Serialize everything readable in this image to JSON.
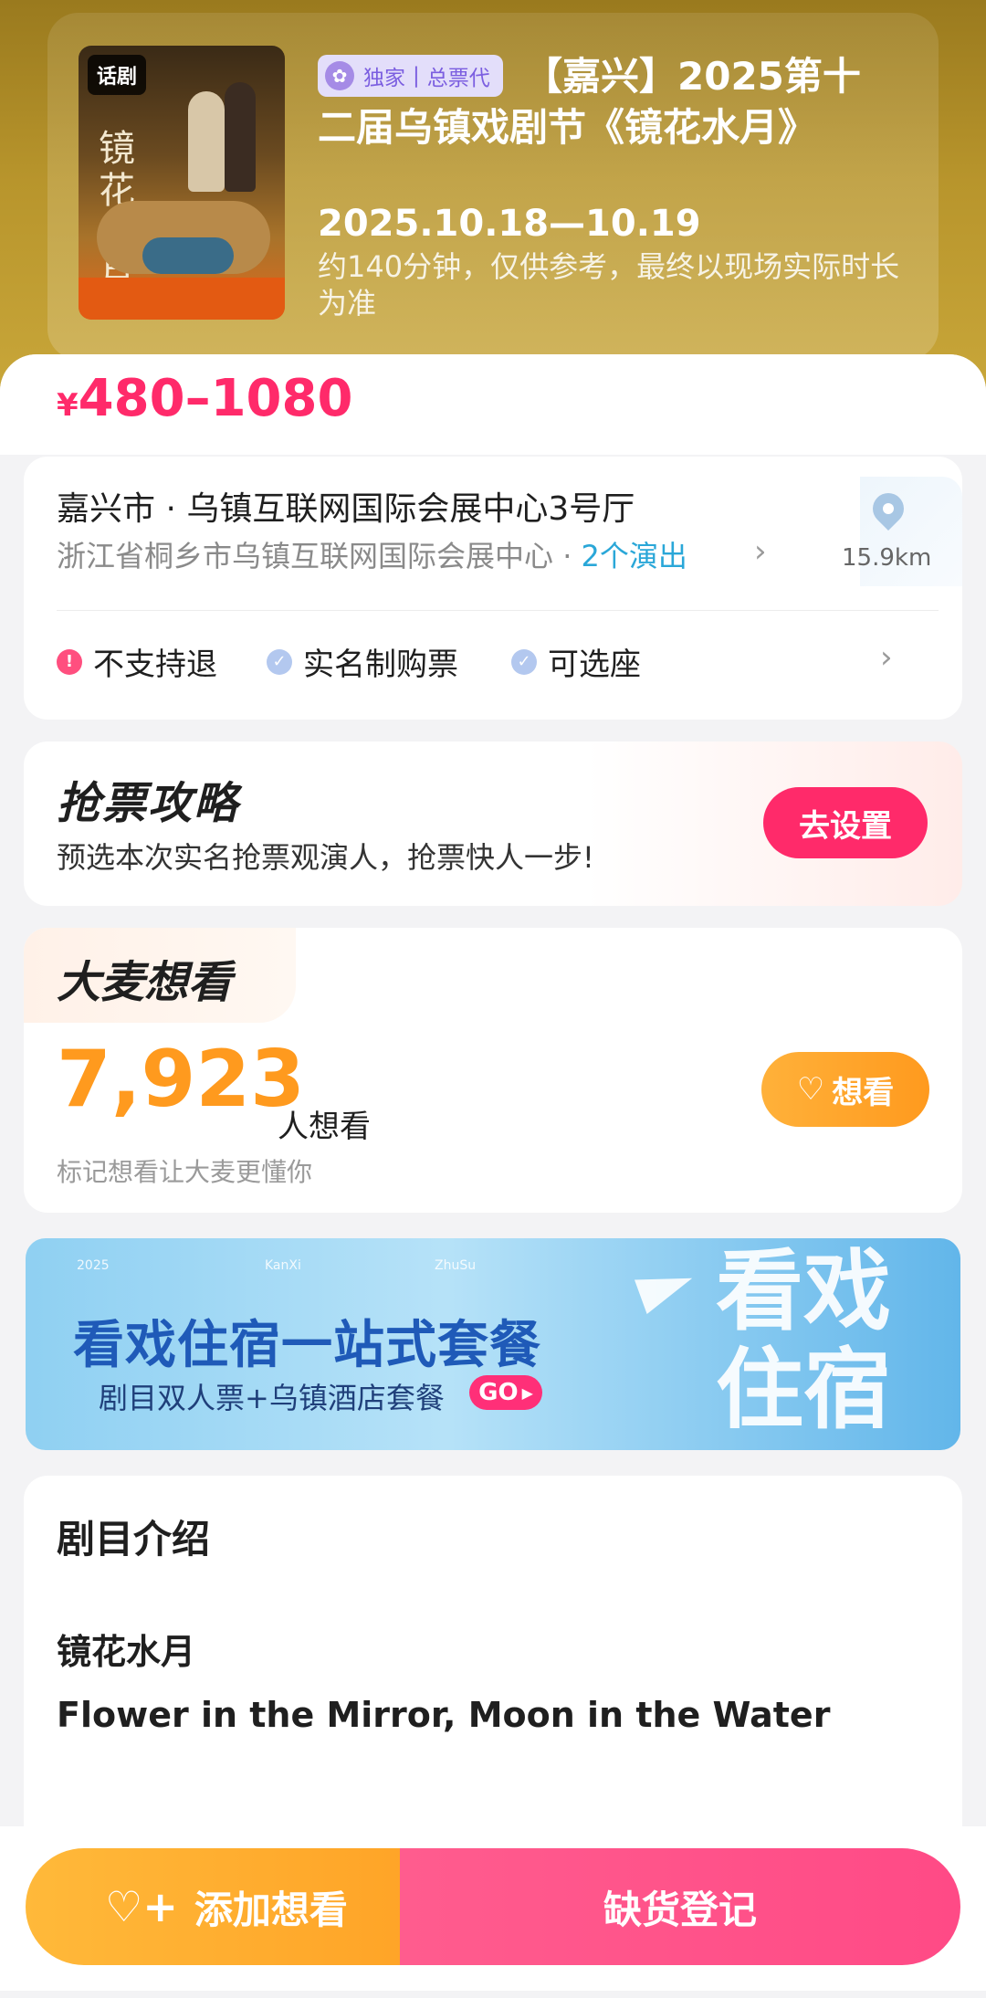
{
  "hero": {
    "poster_tag": "话剧",
    "poster_title": "镜花水月",
    "badge_exclusive": "独家",
    "badge_agent": "总票代",
    "title": "【嘉兴】2025第十二届乌镇戏剧节《镜花水月》",
    "date": "2025.10.18—10.19",
    "duration": "约140分钟，仅供参考，最终以现场实际时长为准"
  },
  "price": {
    "currency": "¥",
    "range": "480–1080"
  },
  "venue": {
    "city_line": "嘉兴市 · 乌镇互联网国际会展中心3号厅",
    "address": "浙江省桐乡市乌镇互联网国际会展中心",
    "shows": "2个演出",
    "distance": "15.9km"
  },
  "policies": [
    {
      "label": "不支持退",
      "type": "warning"
    },
    {
      "label": "实名制购票",
      "type": "check"
    },
    {
      "label": "可选座",
      "type": "check"
    }
  ],
  "grab": {
    "title": "抢票攻略",
    "desc": "预选本次实名抢票观演人，抢票快人一步!",
    "button": "去设置"
  },
  "want": {
    "label": "大麦想看",
    "count": "7,923",
    "unit": "人想看",
    "hint": "标记想看让大麦更懂你",
    "button": "想看"
  },
  "banner": {
    "meta": [
      "2025",
      "KanXi",
      "ZhuSu"
    ],
    "title": "看戏住宿一站式套餐",
    "sub": "剧目双人票+乌镇酒店套餐",
    "go": "GO",
    "big": "看戏住宿"
  },
  "intro": {
    "heading": "剧目介绍",
    "name": "镜花水月",
    "english": "Flower in the Mirror, Moon in the Water"
  },
  "actions": {
    "add_want": "添加想看",
    "register": "缺货登记"
  },
  "colors": {
    "accent": "#ff2a6a",
    "orange": "#ff9a1e",
    "link": "#2aa7d8"
  }
}
